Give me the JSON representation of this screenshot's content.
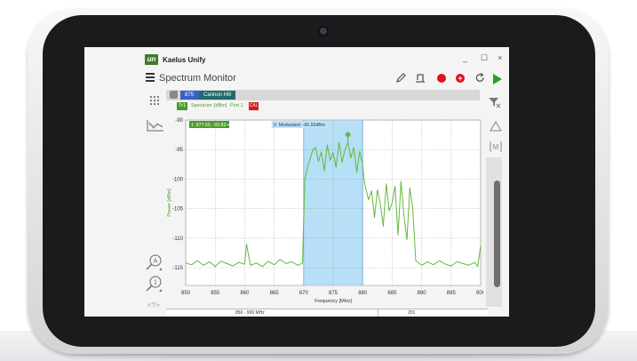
{
  "app": {
    "name": "Kaelus Unify",
    "logo_text": "un",
    "view_title": "Spectrum Monitor",
    "window_controls": [
      "_",
      "☐",
      "×"
    ]
  },
  "trace": {
    "chip_number": "875",
    "site_name": "Cannon Hill",
    "tr_label": "Tr1",
    "mode": "Spectrum",
    "units": "[dBm]",
    "port": "Port 1",
    "cal": "CAL"
  },
  "colors": {
    "accent_green": "#4c9b2c",
    "record_red": "#e01020",
    "chip_blue": "#3a5fc8",
    "chip_teal": "#1e6c6a",
    "highlight_band": "#9fd4f2",
    "trace_line": "#64b83c"
  },
  "icons": {
    "menu": "menu-icon",
    "pencil": "pencil-icon",
    "export": "export-icon",
    "record": "record-icon",
    "add": "add-icon",
    "refresh": "refresh-icon",
    "play": "play-icon",
    "grid": "grid-icon",
    "tag": "tag-icon",
    "chart_type": "chart-type-icon",
    "marker_filter": "marker-filter-icon",
    "delta": "delta-icon",
    "peak": "peak-icon",
    "zoom_auto": "zoom-auto-icon",
    "zoom_one": "zoom-one-icon",
    "help": "help-icon"
  },
  "side": {
    "zoom_a_label": "A",
    "zoom_1_label": "1",
    "peak_label": "M",
    "nav_hint": "<?>"
  },
  "footer": {
    "band": "850 - 900 MHz",
    "value": "201"
  },
  "chart_data": {
    "type": "line",
    "xlabel": "Frequency [MHz]",
    "ylabel": "Power [dBm]",
    "xlim": [
      850,
      900
    ],
    "ylim": [
      -118,
      -90
    ],
    "x_ticks": [
      850,
      855,
      860,
      865,
      870,
      875,
      880,
      885,
      890,
      895,
      900
    ],
    "y_ticks": [
      -90,
      -95,
      -100,
      -105,
      -110,
      -115
    ],
    "marker_label": "1: 877.50, -93.83 ➡",
    "band_label": "0: Modulated: -66.50dBm",
    "band": [
      870,
      880
    ],
    "marker_x": 877.5,
    "grid": true,
    "x": [
      850,
      851,
      852,
      853,
      854,
      855,
      856,
      857,
      858,
      859,
      860,
      860.3,
      861,
      862,
      863,
      864,
      865,
      866,
      867,
      868,
      869,
      869.8,
      870.2,
      870.8,
      871.5,
      872,
      872.5,
      873,
      873.5,
      874,
      874.5,
      875,
      875.5,
      876,
      876.5,
      877,
      877.5,
      878,
      878.5,
      879,
      879.5,
      880,
      880.3,
      881,
      881.5,
      882,
      882.5,
      883,
      883.5,
      884,
      884.5,
      885,
      885.5,
      886,
      886.5,
      887,
      887.5,
      888,
      888.5,
      889,
      889.5,
      890,
      891,
      892,
      893,
      894,
      895,
      896,
      897,
      898,
      899,
      899.5,
      900
    ],
    "values": [
      -114.2,
      -114.5,
      -113.8,
      -114.6,
      -114.0,
      -114.8,
      -113.9,
      -114.3,
      -114.7,
      -114.1,
      -114.4,
      -111.0,
      -114.6,
      -114.2,
      -114.8,
      -113.9,
      -114.5,
      -113.6,
      -114.3,
      -114.0,
      -114.6,
      -114.2,
      -100.0,
      -97.5,
      -95.2,
      -94.6,
      -97.0,
      -95.4,
      -98.6,
      -94.2,
      -96.8,
      -95.5,
      -98.0,
      -93.8,
      -97.2,
      -95.0,
      -93.8,
      -96.4,
      -94.6,
      -98.8,
      -95.3,
      -97.6,
      -100.6,
      -103.5,
      -102.0,
      -106.5,
      -101.8,
      -104.2,
      -108.0,
      -100.8,
      -105.4,
      -104.0,
      -101.2,
      -109.5,
      -100.4,
      -106.2,
      -110.3,
      -101.5,
      -105.0,
      -113.8,
      -114.2,
      -114.6,
      -114.0,
      -114.5,
      -113.8,
      -114.4,
      -114.7,
      -114.0,
      -114.3,
      -114.6,
      -114.1,
      -114.8,
      -111.3
    ]
  }
}
